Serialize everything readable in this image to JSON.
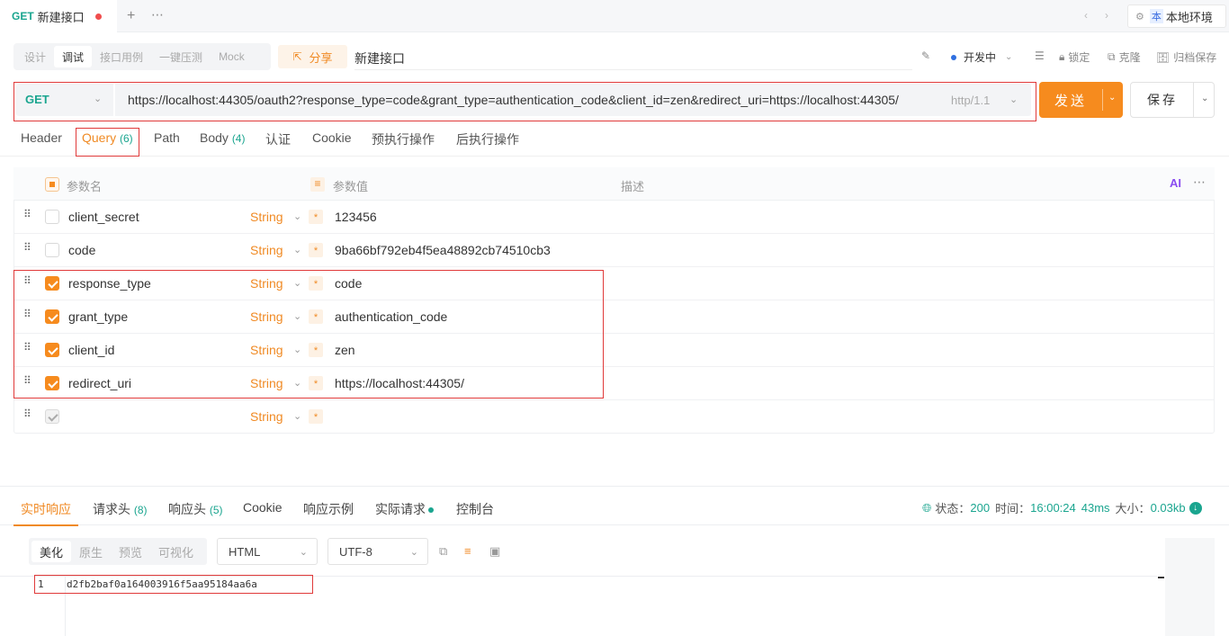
{
  "top_tab": {
    "method": "GET",
    "title": "新建接口"
  },
  "env": {
    "badge": "本",
    "label": "本地环境"
  },
  "modes": [
    "设计",
    "调试",
    "接口用例",
    "一键压测",
    "Mock"
  ],
  "share_label": "分享",
  "api_name": "新建接口",
  "tools": {
    "status": "开发中",
    "lock": "锁定",
    "clone": "克隆",
    "archive": "归档保存"
  },
  "request": {
    "method": "GET",
    "url": "https://localhost:44305/oauth2?response_type=code&grant_type=authentication_code&client_id=zen&redirect_uri=https://localhost:44305/",
    "protocol": "http/1.1",
    "send_label": "发送",
    "save_label": "保存"
  },
  "param_tabs": {
    "header": "Header",
    "query": "Query",
    "query_count": "(6)",
    "path": "Path",
    "body": "Body",
    "body_count": "(4)",
    "auth": "认证",
    "cookie": "Cookie",
    "pre": "预执行操作",
    "post": "后执行操作"
  },
  "table_headers": {
    "name": "参数名",
    "value": "参数值",
    "desc": "描述",
    "ai": "AI"
  },
  "params": [
    {
      "name": "client_secret",
      "type": "String",
      "value": "123456",
      "checked": false
    },
    {
      "name": "code",
      "type": "String",
      "value": "9ba66bf792eb4f5ea48892cb74510cb3",
      "checked": false
    },
    {
      "name": "response_type",
      "type": "String",
      "value": "code",
      "checked": true
    },
    {
      "name": "grant_type",
      "type": "String",
      "value": "authentication_code",
      "checked": true
    },
    {
      "name": "client_id",
      "type": "String",
      "value": "zen",
      "checked": true
    },
    {
      "name": "redirect_uri",
      "type": "String",
      "value": "https://localhost:44305/",
      "checked": true
    },
    {
      "name": "",
      "type": "String",
      "value": "",
      "checked": "disabled"
    }
  ],
  "response_tabs": {
    "live": "实时响应",
    "req_headers": "请求头",
    "req_headers_count": "(8)",
    "resp_headers": "响应头",
    "resp_headers_count": "(5)",
    "cookie": "Cookie",
    "example": "响应示例",
    "actual": "实际请求",
    "console": "控制台"
  },
  "status": {
    "status_label": "状态：",
    "status_value": "200",
    "time_label": "时间：",
    "time_value": "16:00:24",
    "duration": "43ms",
    "size_label": "大小：",
    "size_value": "0.03kb"
  },
  "view_modes": [
    "美化",
    "原生",
    "预览",
    "可视化"
  ],
  "format": "HTML",
  "encoding": "UTF-8",
  "response_body": {
    "line": "1",
    "text": "d2fb2baf0a164003916f5aa95184aa6a"
  }
}
